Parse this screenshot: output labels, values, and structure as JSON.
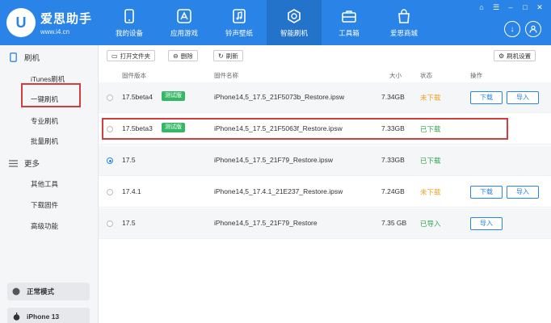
{
  "app": {
    "title": "爱思助手",
    "url": "www.i4.cn",
    "logo_letter": "U"
  },
  "nav": [
    {
      "label": "我的设备",
      "icon": "phone-icon"
    },
    {
      "label": "应用游戏",
      "icon": "apps-icon"
    },
    {
      "label": "铃声壁纸",
      "icon": "music-icon"
    },
    {
      "label": "智能刷机",
      "icon": "flash-icon"
    },
    {
      "label": "工具箱",
      "icon": "toolbox-icon"
    },
    {
      "label": "爱思商城",
      "icon": "shop-icon"
    }
  ],
  "sidebar": {
    "section_flash": "刷机",
    "items_flash": [
      "iTunes刷机",
      "一键刷机",
      "专业刷机",
      "批量刷机"
    ],
    "section_more": "更多",
    "items_more": [
      "其他工具",
      "下载固件",
      "高级功能"
    ],
    "mode": "正常模式",
    "device": "iPhone 13"
  },
  "toolbar": {
    "open_folder": "打开文件夹",
    "delete": "删除",
    "refresh": "刷新",
    "flash_settings": "刷机设置"
  },
  "table": {
    "headers": {
      "version": "固件版本",
      "name": "固件名称",
      "size": "大小",
      "status": "状态",
      "action": "操作"
    },
    "rows": [
      {
        "version": "17.5beta4",
        "badge": "测试版",
        "name": "iPhone14,5_17.5_21F5073b_Restore.ipsw",
        "size": "7.34GB",
        "status": "未下载",
        "status_type": "no",
        "actions": [
          "下载",
          "导入"
        ]
      },
      {
        "version": "17.5beta3",
        "badge": "测试版",
        "name": "iPhone14,5_17.5_21F5063f_Restore.ipsw",
        "size": "7.33GB",
        "status": "已下载",
        "status_type": "ok",
        "actions": []
      },
      {
        "version": "17.5",
        "badge": "",
        "name": "iPhone14,5_17.5_21F79_Restore.ipsw",
        "size": "7.33GB",
        "status": "已下载",
        "status_type": "ok",
        "actions": []
      },
      {
        "version": "17.4.1",
        "badge": "",
        "name": "iPhone14,5_17.4.1_21E237_Restore.ipsw",
        "size": "7.24GB",
        "status": "未下载",
        "status_type": "no",
        "actions": [
          "下载",
          "导入"
        ]
      },
      {
        "version": "17.5",
        "badge": "",
        "name": "iPhone14,5_17.5_21F79_Restore",
        "size": "7.35 GB",
        "status": "已导入",
        "status_type": "ok",
        "actions": [
          "导入"
        ]
      }
    ]
  }
}
